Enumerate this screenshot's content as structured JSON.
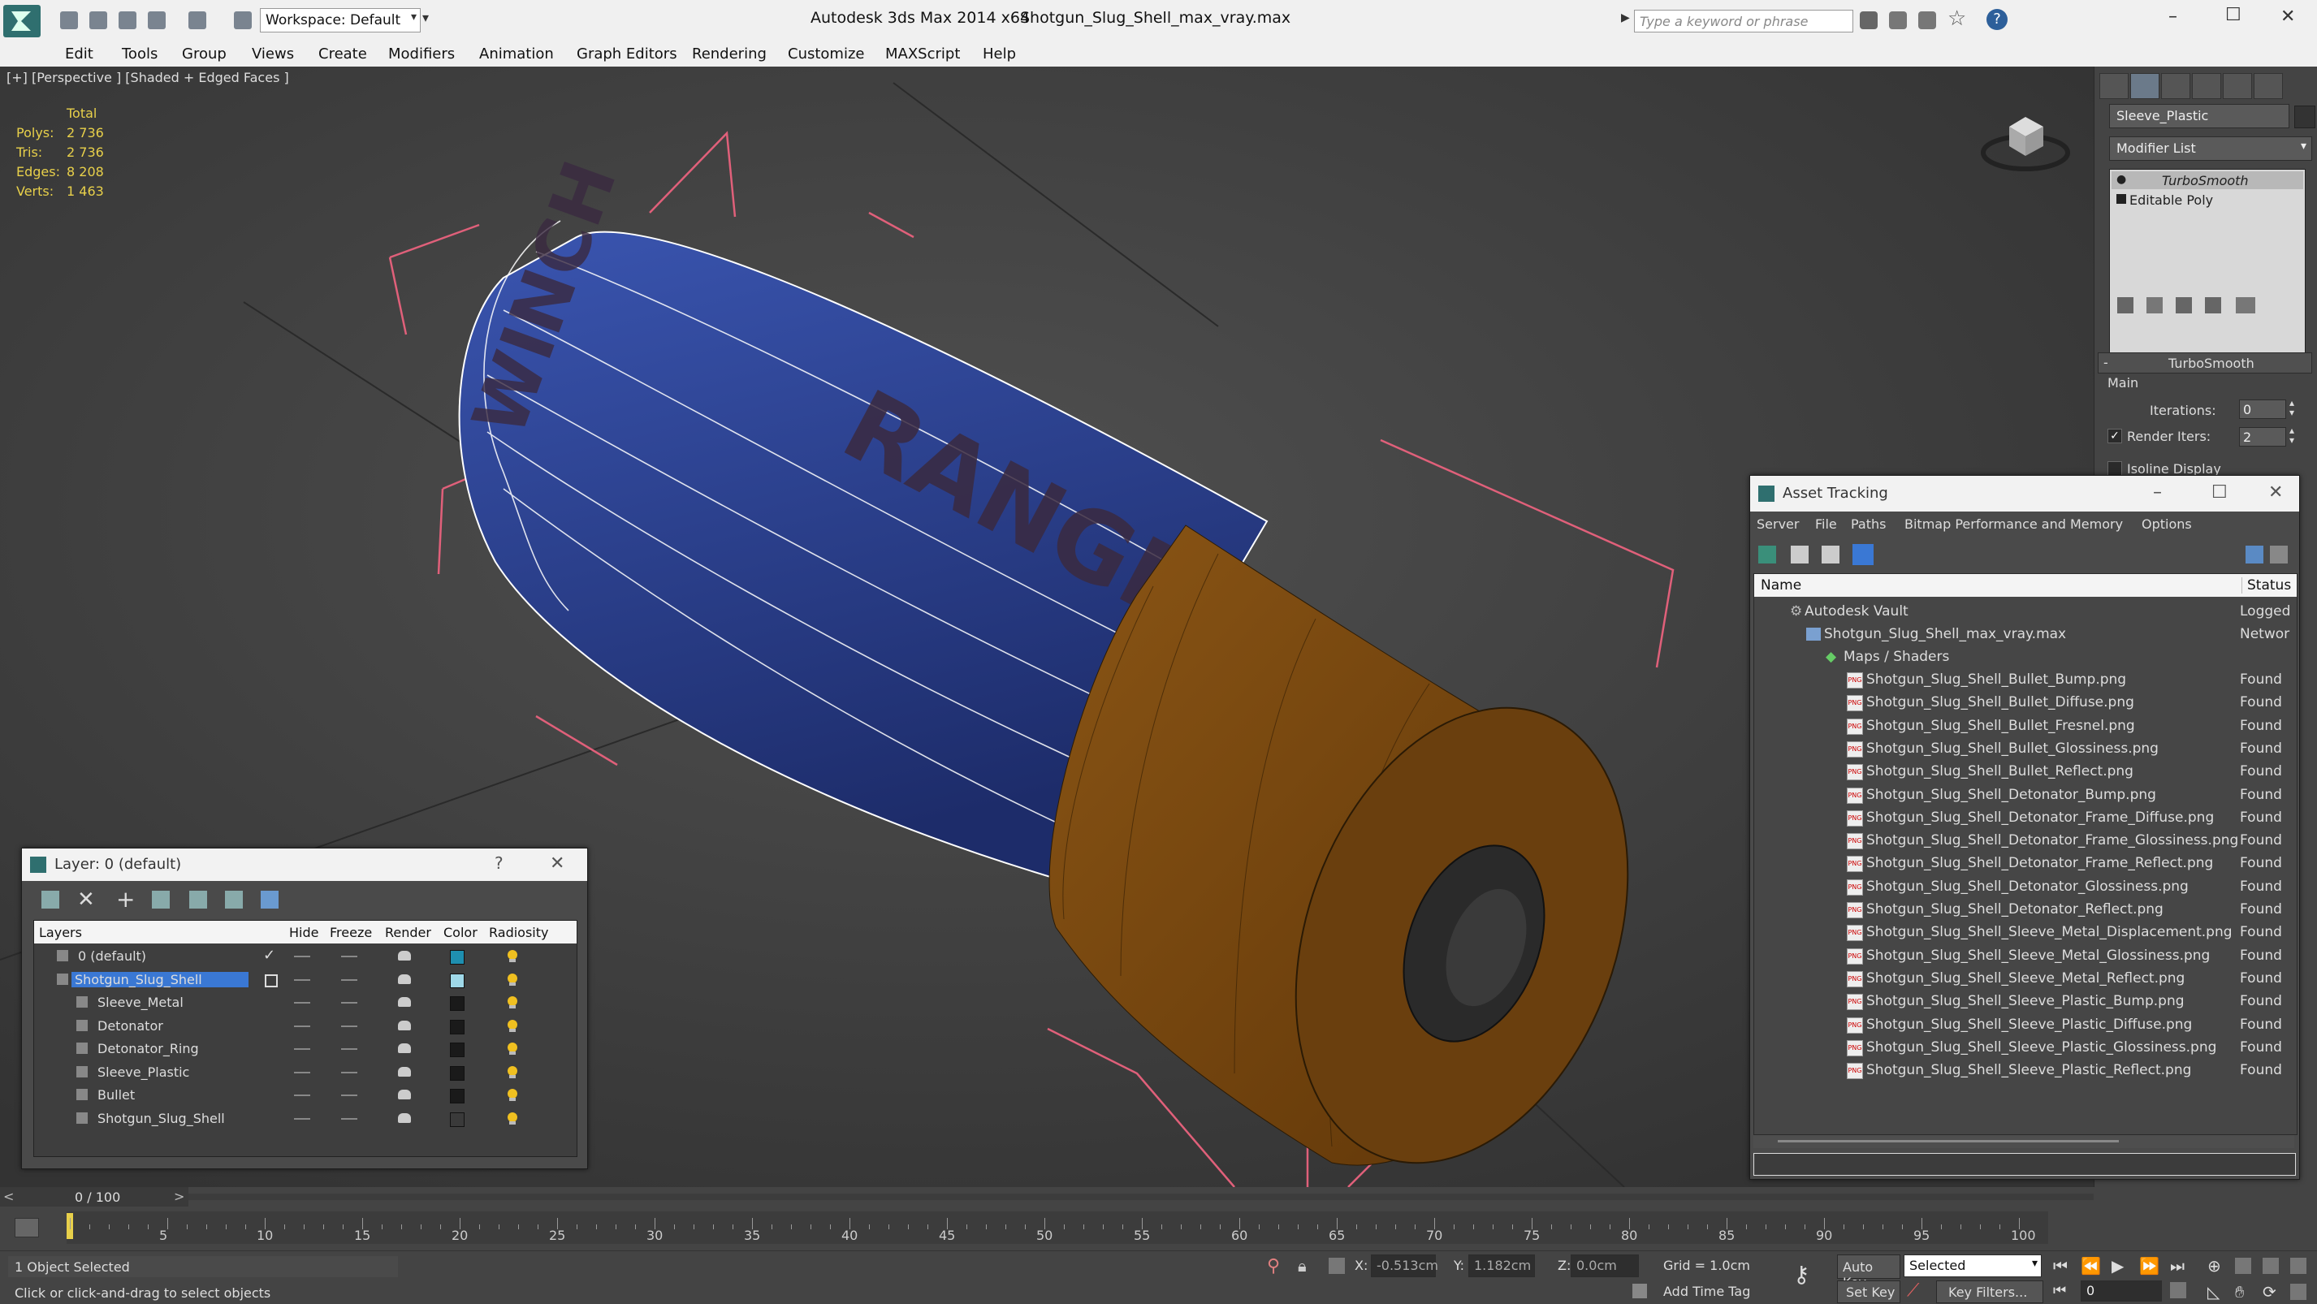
{
  "title_bar": {
    "app_title": "Autodesk 3ds Max  2014 x64",
    "file_title": "Shotgun_Slug_Shell_max_vray.max",
    "workspace": "Workspace: Default",
    "search_placeholder": "Type a keyword or phrase",
    "min_symbol": "–",
    "max_symbol": "☐",
    "close_symbol": "✕"
  },
  "menu": [
    "Edit",
    "Tools",
    "Group",
    "Views",
    "Create",
    "Modifiers",
    "Animation",
    "Graph Editors",
    "Rendering",
    "Customize",
    "MAXScript",
    "Help"
  ],
  "viewport": {
    "label": "[+] [Perspective ] [Shaded + Edged Faces ]",
    "stats": {
      "total_label": "Total",
      "rows": [
        {
          "label": "Polys:",
          "value": "2 736"
        },
        {
          "label": "Tris:",
          "value": "2 736"
        },
        {
          "label": "Edges:",
          "value": "8 208"
        },
        {
          "label": "Verts:",
          "value": "1 463"
        }
      ]
    },
    "shell_text_1": "RANGE",
    "shell_text_2": "WINCH"
  },
  "command_panel": {
    "object_name": "Sleeve_Plastic",
    "modifier_list": "Modifier List",
    "stack": [
      "TurboSmooth",
      "Editable Poly"
    ],
    "rollout_title": "TurboSmooth",
    "group_main": "Main",
    "iterations_label": "Iterations:",
    "iterations_value": "0",
    "render_iters_label": "Render Iters:",
    "render_iters_value": "2",
    "isoline_label": "Isoline Display"
  },
  "asset_tracking": {
    "title": "Asset Tracking",
    "menu": [
      "Server",
      "File",
      "Paths",
      "Bitmap Performance and Memory",
      "Options"
    ],
    "col_name": "Name",
    "col_status": "Status",
    "vault": {
      "name": "Autodesk Vault",
      "status": "Logged"
    },
    "file": {
      "name": "Shotgun_Slug_Shell_max_vray.max",
      "status": "Networ"
    },
    "maps": {
      "name": "Maps / Shaders"
    },
    "items": [
      {
        "name": "Shotgun_Slug_Shell_Bullet_Bump.png",
        "status": "Found"
      },
      {
        "name": "Shotgun_Slug_Shell_Bullet_Diffuse.png",
        "status": "Found"
      },
      {
        "name": "Shotgun_Slug_Shell_Bullet_Fresnel.png",
        "status": "Found"
      },
      {
        "name": "Shotgun_Slug_Shell_Bullet_Glossiness.png",
        "status": "Found"
      },
      {
        "name": "Shotgun_Slug_Shell_Bullet_Reflect.png",
        "status": "Found"
      },
      {
        "name": "Shotgun_Slug_Shell_Detonator_Bump.png",
        "status": "Found"
      },
      {
        "name": "Shotgun_Slug_Shell_Detonator_Frame_Diffuse.png",
        "status": "Found"
      },
      {
        "name": "Shotgun_Slug_Shell_Detonator_Frame_Glossiness.png",
        "status": "Found"
      },
      {
        "name": "Shotgun_Slug_Shell_Detonator_Frame_Reflect.png",
        "status": "Found"
      },
      {
        "name": "Shotgun_Slug_Shell_Detonator_Glossiness.png",
        "status": "Found"
      },
      {
        "name": "Shotgun_Slug_Shell_Detonator_Reflect.png",
        "status": "Found"
      },
      {
        "name": "Shotgun_Slug_Shell_Sleeve_Metal_Displacement.png",
        "status": "Found"
      },
      {
        "name": "Shotgun_Slug_Shell_Sleeve_Metal_Glossiness.png",
        "status": "Found"
      },
      {
        "name": "Shotgun_Slug_Shell_Sleeve_Metal_Reflect.png",
        "status": "Found"
      },
      {
        "name": "Shotgun_Slug_Shell_Sleeve_Plastic_Bump.png",
        "status": "Found"
      },
      {
        "name": "Shotgun_Slug_Shell_Sleeve_Plastic_Diffuse.png",
        "status": "Found"
      },
      {
        "name": "Shotgun_Slug_Shell_Sleeve_Plastic_Glossiness.png",
        "status": "Found"
      },
      {
        "name": "Shotgun_Slug_Shell_Sleeve_Plastic_Reflect.png",
        "status": "Found"
      }
    ]
  },
  "layer_manager": {
    "title": "Layer: 0 (default)",
    "help_symbol": "?",
    "columns": [
      "Layers",
      "Hide",
      "Freeze",
      "Render",
      "Color",
      "Radiosity"
    ],
    "rows": [
      {
        "name": "0 (default)",
        "color": "#1f8fb0",
        "selected": false
      },
      {
        "name": "Shotgun_Slug_Shell",
        "color": "#9fd8e8",
        "selected": true
      },
      {
        "name": "Sleeve_Metal",
        "color": "#1a1a1a",
        "selected": false
      },
      {
        "name": "Detonator",
        "color": "#1a1a1a",
        "selected": false
      },
      {
        "name": "Detonator_Ring",
        "color": "#1a1a1a",
        "selected": false
      },
      {
        "name": "Sleeve_Plastic",
        "color": "#1a1a1a",
        "selected": false
      },
      {
        "name": "Bullet",
        "color": "#1a1a1a",
        "selected": false
      },
      {
        "name": "Shotgun_Slug_Shell",
        "color": "#3a3a3a",
        "selected": false
      }
    ]
  },
  "timeline": {
    "frame_counter": "0 / 100",
    "ticks": [
      "5",
      "10",
      "15",
      "20",
      "25",
      "30",
      "35",
      "40",
      "45",
      "50",
      "55",
      "60",
      "65",
      "70",
      "75",
      "80",
      "85",
      "90",
      "95",
      "100"
    ]
  },
  "status_bar": {
    "selection_info": "1 Object Selected",
    "prompt": "Click or click-and-drag to select objects",
    "x_label": "X:",
    "x_value": "-0.513cm",
    "y_label": "Y:",
    "y_value": "1.182cm",
    "z_label": "Z:",
    "z_value": "0.0cm",
    "grid": "Grid = 1.0cm",
    "add_time_tag": "Add Time Tag",
    "auto_key": "Auto Key",
    "selected_dropdown": "Selected",
    "set_key": "Set Key",
    "key_filters": "Key Filters...",
    "frame_value": "0"
  },
  "colors": {
    "sleeve_blue": "#2c3f8c",
    "brass": "#7a4a12",
    "selection_box": "#e0607a",
    "stat_yellow": "#e8d04a",
    "layer_select": "#3a78d4"
  }
}
